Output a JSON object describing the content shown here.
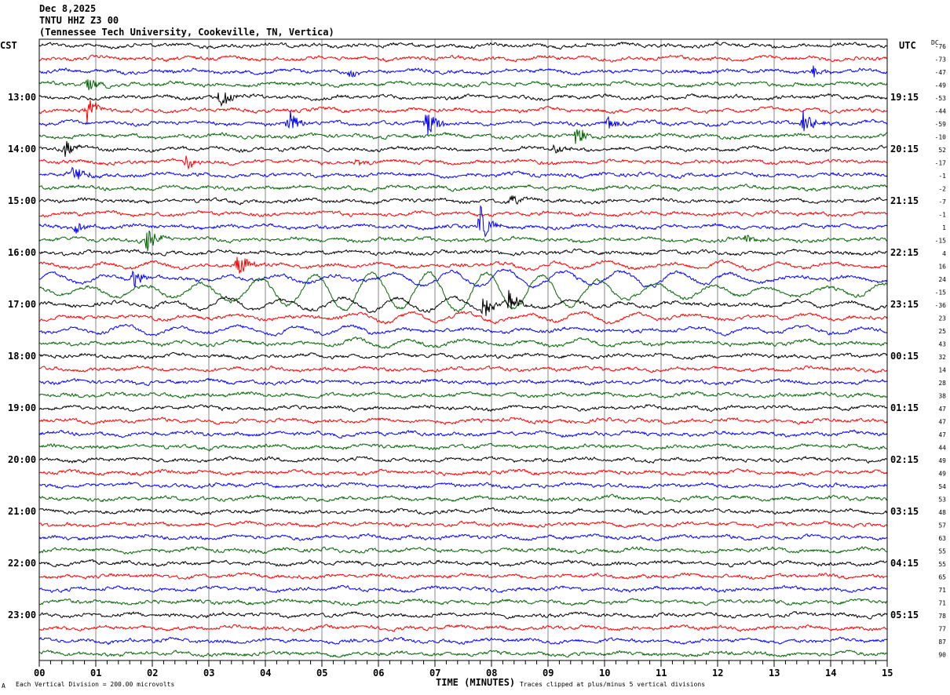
{
  "header": {
    "date": "Dec 8,2025",
    "station": "TNTU HHZ Z3 00",
    "location": "(Tennessee Tech University, Cookeville, TN, Vertica)"
  },
  "chart_data": {
    "type": "line",
    "title": "Dec 8,2025",
    "left_axis_title": "CST",
    "right_axis_title": "UTC",
    "dc_label": "DC",
    "xlabel": "TIME (MINUTES)",
    "xlim": [
      0,
      15
    ],
    "x_ticks": [
      "00",
      "01",
      "02",
      "03",
      "04",
      "05",
      "06",
      "07",
      "08",
      "09",
      "10",
      "11",
      "12",
      "13",
      "14",
      "15"
    ],
    "grid": true,
    "trace_count": 48,
    "trace_colors": [
      "#000000",
      "#ff0000",
      "#0000ff",
      "#006400"
    ],
    "left_time_labels": [
      {
        "row": 4,
        "label": "13:00"
      },
      {
        "row": 8,
        "label": "14:00"
      },
      {
        "row": 12,
        "label": "15:00"
      },
      {
        "row": 16,
        "label": "16:00"
      },
      {
        "row": 20,
        "label": "17:00"
      },
      {
        "row": 24,
        "label": "18:00"
      },
      {
        "row": 28,
        "label": "19:00"
      },
      {
        "row": 32,
        "label": "20:00"
      },
      {
        "row": 36,
        "label": "21:00"
      },
      {
        "row": 40,
        "label": "22:00"
      },
      {
        "row": 44,
        "label": "23:00"
      }
    ],
    "right_time_labels": [
      {
        "row": 4,
        "label": "19:15"
      },
      {
        "row": 8,
        "label": "20:15"
      },
      {
        "row": 12,
        "label": "21:15"
      },
      {
        "row": 16,
        "label": "22:15"
      },
      {
        "row": 20,
        "label": "23:15"
      },
      {
        "row": 24,
        "label": "00:15"
      },
      {
        "row": 28,
        "label": "01:15"
      },
      {
        "row": 32,
        "label": "02:15"
      },
      {
        "row": 36,
        "label": "03:15"
      },
      {
        "row": 40,
        "label": "04:15"
      },
      {
        "row": 44,
        "label": "05:15"
      }
    ],
    "dc_offsets": [
      "-76",
      "-73",
      "-47",
      "-49",
      "-53",
      "-44",
      "-59",
      "-10",
      "52",
      "-17",
      "-1",
      "-2",
      "-7",
      "-1",
      "1",
      "-15",
      "4",
      "16",
      "24",
      "-15",
      "-36",
      "23",
      "25",
      "43",
      "32",
      "14",
      "28",
      "38",
      "47",
      "47",
      "47",
      "44",
      "49",
      "49",
      "54",
      "53",
      "48",
      "57",
      "63",
      "55",
      "55",
      "65",
      "71",
      "71",
      "78",
      "77",
      "87",
      "90"
    ],
    "events": [
      {
        "row": 2,
        "minute": 5.5,
        "amplitude": 0.3
      },
      {
        "row": 2,
        "minute": 13.7,
        "amplitude": 0.5
      },
      {
        "row": 3,
        "minute": 0.85,
        "amplitude": 0.6
      },
      {
        "row": 4,
        "minute": 3.2,
        "amplitude": 1.0
      },
      {
        "row": 5,
        "minute": 0.85,
        "amplitude": 1.3
      },
      {
        "row": 6,
        "minute": 4.4,
        "amplitude": 1.1
      },
      {
        "row": 6,
        "minute": 6.85,
        "amplitude": 1.4
      },
      {
        "row": 6,
        "minute": 10.05,
        "amplitude": 0.6
      },
      {
        "row": 6,
        "minute": 13.5,
        "amplitude": 1.2
      },
      {
        "row": 7,
        "minute": 9.5,
        "amplitude": 0.9
      },
      {
        "row": 8,
        "minute": 0.45,
        "amplitude": 0.8
      },
      {
        "row": 8,
        "minute": 9.1,
        "amplitude": 0.5
      },
      {
        "row": 9,
        "minute": 2.6,
        "amplitude": 0.6
      },
      {
        "row": 9,
        "minute": 5.6,
        "amplitude": 0.3
      },
      {
        "row": 10,
        "minute": 0.6,
        "amplitude": 1.0
      },
      {
        "row": 12,
        "minute": 8.35,
        "amplitude": 0.5
      },
      {
        "row": 14,
        "minute": 0.65,
        "amplitude": 0.5
      },
      {
        "row": 14,
        "minute": 7.8,
        "amplitude": 1.6
      },
      {
        "row": 15,
        "minute": 1.9,
        "amplitude": 1.1
      },
      {
        "row": 15,
        "minute": 12.5,
        "amplitude": 0.4
      },
      {
        "row": 17,
        "minute": 3.5,
        "amplitude": 1.2
      },
      {
        "row": 18,
        "minute": 1.65,
        "amplitude": 0.9
      },
      {
        "row": 20,
        "minute": 7.85,
        "amplitude": 1.4
      },
      {
        "row": 20,
        "minute": 8.3,
        "amplitude": 1.0
      }
    ],
    "long_period_rows": [
      {
        "row": 17,
        "amplitude": 0.25
      },
      {
        "row": 18,
        "amplitude": 0.6
      },
      {
        "row": 19,
        "amplitude": 1.5
      },
      {
        "row": 20,
        "amplitude": 0.5
      },
      {
        "row": 21,
        "amplitude": 0.35
      },
      {
        "row": 22,
        "amplitude": 0.3
      },
      {
        "row": 23,
        "amplitude": 0.25
      }
    ]
  },
  "footer": {
    "scale_note": "Each Vertical Division =  200.00 microvolts",
    "clip_note": "Traces clipped at plus/minus 5 vertical divisions",
    "corner_mark": "A"
  }
}
